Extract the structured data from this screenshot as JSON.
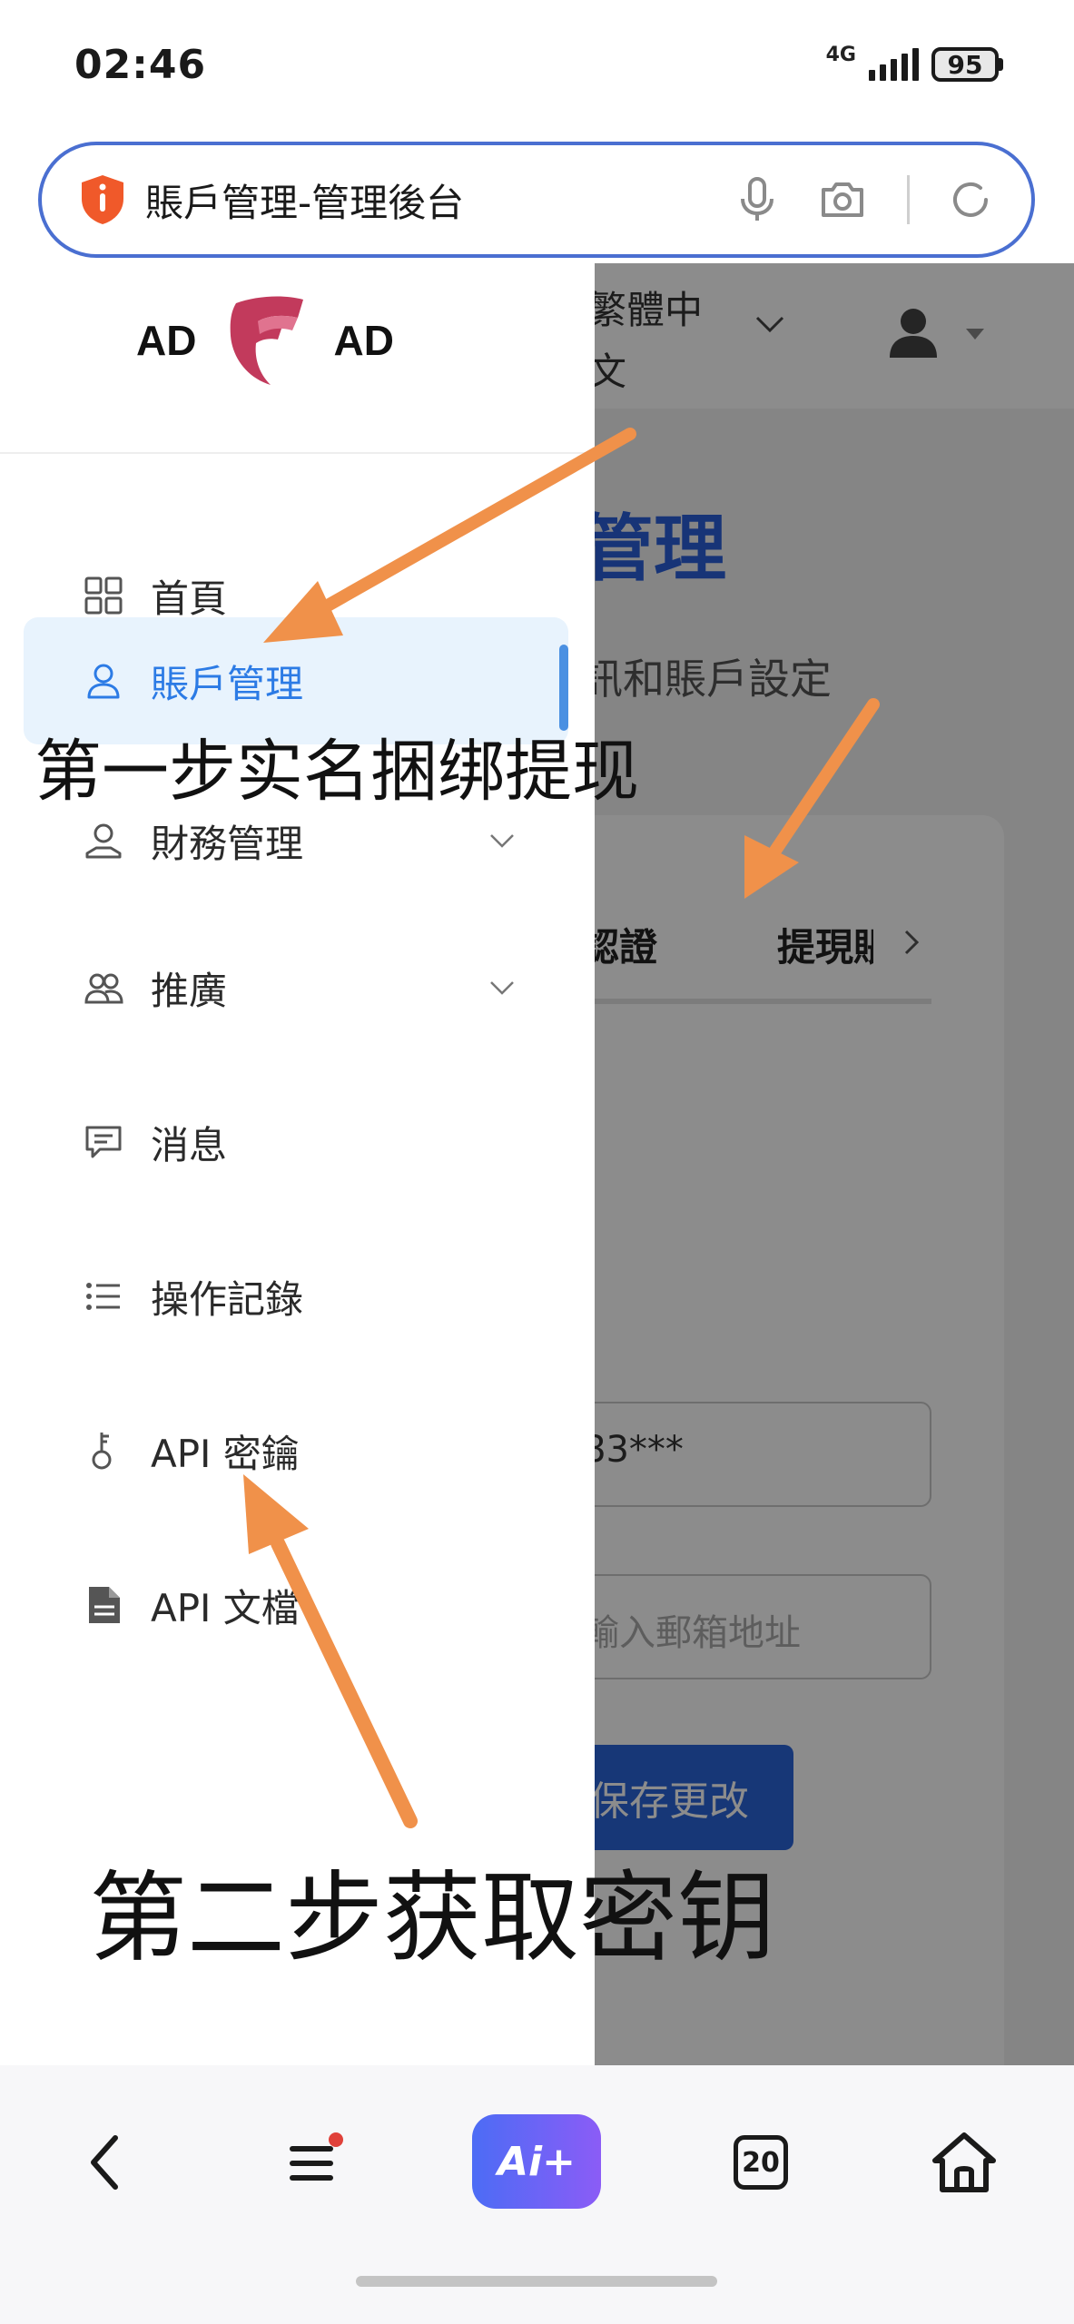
{
  "status_bar": {
    "time": "02:46",
    "network": "4G",
    "battery": "95"
  },
  "browser": {
    "page_title": "賬戶管理-管理後台"
  },
  "header": {
    "language_line1": "繁體中",
    "language_line2": "文"
  },
  "logo": {
    "left_text": "AD",
    "right_text": "AD"
  },
  "sidebar": {
    "items": [
      {
        "label": "首頁",
        "icon": "dashboard-icon"
      },
      {
        "label": "賬戶管理",
        "icon": "user-icon",
        "active": true
      },
      {
        "label": "財務管理",
        "icon": "finance-icon",
        "expandable": true
      },
      {
        "label": "推廣",
        "icon": "users-icon",
        "expandable": true
      },
      {
        "label": "消息",
        "icon": "message-icon"
      },
      {
        "label": "操作記錄",
        "icon": "list-icon"
      },
      {
        "label": "API 密鑰",
        "icon": "key-icon"
      },
      {
        "label": "API 文檔",
        "icon": "document-icon"
      }
    ]
  },
  "background_page": {
    "title": "管理",
    "subtitle": "訊和賬戶設定",
    "tab_1": "認證",
    "tab_2": "提現賬戶",
    "masked_value": "83***",
    "email_placeholder": "輸入郵箱地址",
    "save_button": "保存更改"
  },
  "annotations": {
    "step_1": "第一步实名捆绑提现",
    "step_2": "第二步获取密钥",
    "arrow_color": "#f0914a"
  },
  "bottom_nav": {
    "ai_label": "Ai+",
    "tab_count": "20"
  },
  "colors": {
    "accent": "#2c7be5",
    "address_border": "#4a6fd1",
    "brand": "#c23a5c"
  }
}
